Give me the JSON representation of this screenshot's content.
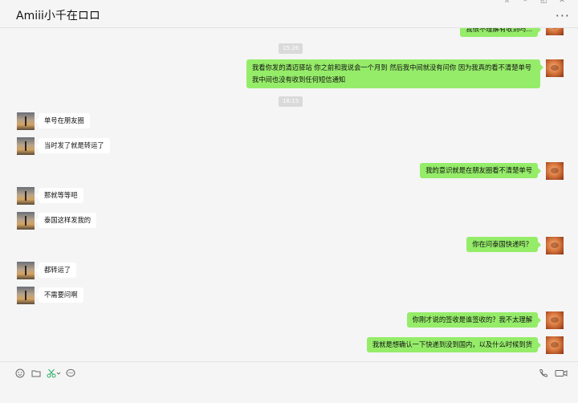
{
  "window": {
    "title": "Amiii小千在ロロ",
    "controls": [
      "pin-icon",
      "minimize-icon",
      "maximize-icon",
      "close-icon"
    ],
    "more_label": "···"
  },
  "timestamps": [
    "15:26",
    "16:15"
  ],
  "messages": [
    {
      "side": "me",
      "text": "我很不理解有收到吗..."
    },
    {
      "side": "me",
      "text": "我看你发的清迈驿站  你之前和我说会一个月到  然后我中间就没有问你  因为我真的看不清楚单号  我中间也没有收到任何短信通知"
    },
    {
      "side": "them",
      "text": "单号在朋友圈"
    },
    {
      "side": "them",
      "text": "当时发了就是转运了"
    },
    {
      "side": "me",
      "text": "我的意识就是在朋友圈看不清楚单号"
    },
    {
      "side": "them",
      "text": "那就等等吧"
    },
    {
      "side": "them",
      "text": "泰国这样发我的"
    },
    {
      "side": "me",
      "text": "你在问泰国快递吗？"
    },
    {
      "side": "them",
      "text": "都转运了"
    },
    {
      "side": "them",
      "text": "不需要问啊"
    },
    {
      "side": "me",
      "text": "你刚才说的签收是谁签收的？我不太理解"
    },
    {
      "side": "me",
      "text": "我就是想确认一下快递到没到国内，以及什么时候到货"
    }
  ],
  "toolbar": {
    "left_icons": [
      "emoji-icon",
      "folder-icon",
      "scissors-icon",
      "chat-history-icon"
    ],
    "right_icons": [
      "phone-icon",
      "video-call-icon"
    ]
  },
  "colors": {
    "my_bubble": "#95ec69",
    "their_bubble": "#ffffff",
    "background": "#f5f5f5"
  }
}
